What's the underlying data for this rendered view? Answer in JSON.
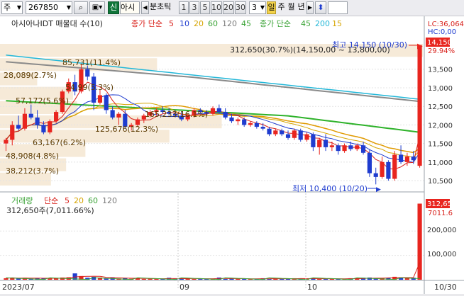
{
  "toolbar": {
    "market": "주",
    "code": "267850",
    "stock_name_short": "아시",
    "credit_badge": "신",
    "period_label": "분초틱",
    "periods": [
      "1",
      "3",
      "5",
      "10",
      "20",
      "30"
    ],
    "count_value": "3",
    "day_label": "일",
    "week_label": "주",
    "month_label": "월",
    "year_label": "년"
  },
  "price_panel": {
    "title": "아시아나IDT 매물대 수(10)",
    "ma_label": "종가 단순",
    "ma_periods": [
      "5",
      "10",
      "20",
      "60",
      "120"
    ],
    "ma_extra_label": "45",
    "ma2_label": "종가 단순",
    "ma2_periods": [
      "45",
      "200",
      "15"
    ],
    "lc_label": "LC:36,064",
    "hc_label": "HC:0,00",
    "current_price_badge": "14,150",
    "pct_badge": "29.94%",
    "price_annotation": "312,650(30.7%)(14,150,00 ~ 13,800,00)",
    "high_annotation": "최고 14,150 (10/30)",
    "low_annotation": "최저 10,400 (10/20)",
    "volume_profile_labels": [
      "85,731(11.4%)",
      "28,089(2.7%)",
      "54,99(5.3%)",
      "57,172(5.6%)",
      "165,233(16.1%)",
      "125,676(12.3%)",
      "63,167(6.2%)",
      "48,908(4.8%)",
      "38,212(3.7%)"
    ],
    "y_ticks": [
      "13,500",
      "13,000",
      "12,500",
      "12,000",
      "11,500",
      "11,000",
      "10,500"
    ]
  },
  "volume_panel": {
    "title": "거래량",
    "ma_label": "단순",
    "ma_periods": [
      "5",
      "20",
      "60",
      "120"
    ],
    "current_label": "312,650주(7,011.66%)",
    "value_badge": "312,65",
    "value_badge2": "7011.6",
    "y_ticks": [
      "200,000",
      "100,000"
    ]
  },
  "x_axis": [
    "2023/07",
    "09",
    "10",
    "10/30"
  ],
  "colors": {
    "up": "#e8251f",
    "down": "#1f3ccf",
    "profile": "#f6ead8"
  },
  "chart_data": {
    "type": "candlestick",
    "title": "아시아나IDT 매물대 수(10)",
    "ylim": [
      10350,
      14200
    ],
    "candles": [
      {
        "o": 11500,
        "h": 11650,
        "l": 11300,
        "c": 11600
      },
      {
        "o": 11600,
        "h": 12100,
        "l": 11450,
        "c": 12000
      },
      {
        "o": 12000,
        "h": 12250,
        "l": 11850,
        "c": 11900
      },
      {
        "o": 11900,
        "h": 12450,
        "l": 11850,
        "c": 12300
      },
      {
        "o": 12300,
        "h": 12550,
        "l": 12150,
        "c": 12200
      },
      {
        "o": 12200,
        "h": 12400,
        "l": 11900,
        "c": 12000
      },
      {
        "o": 12000,
        "h": 12100,
        "l": 11750,
        "c": 11800
      },
      {
        "o": 11800,
        "h": 12150,
        "l": 11750,
        "c": 12100
      },
      {
        "o": 12100,
        "h": 12400,
        "l": 12050,
        "c": 12350
      },
      {
        "o": 12350,
        "h": 12950,
        "l": 12300,
        "c": 12900
      },
      {
        "o": 12900,
        "h": 13250,
        "l": 12850,
        "c": 13150
      },
      {
        "o": 13150,
        "h": 13350,
        "l": 12800,
        "c": 12900
      },
      {
        "o": 12900,
        "h": 13650,
        "l": 12850,
        "c": 13500
      },
      {
        "o": 13500,
        "h": 13600,
        "l": 13200,
        "c": 13300
      },
      {
        "o": 13300,
        "h": 13400,
        "l": 12400,
        "c": 12600
      },
      {
        "o": 12600,
        "h": 12950,
        "l": 12550,
        "c": 12800
      },
      {
        "o": 12800,
        "h": 12850,
        "l": 12300,
        "c": 12400
      },
      {
        "o": 12400,
        "h": 12500,
        "l": 12150,
        "c": 12200
      },
      {
        "o": 12200,
        "h": 12350,
        "l": 12000,
        "c": 12300
      },
      {
        "o": 12300,
        "h": 12400,
        "l": 11900,
        "c": 11950
      },
      {
        "o": 11950,
        "h": 12050,
        "l": 11850,
        "c": 12000
      },
      {
        "o": 12000,
        "h": 12200,
        "l": 11950,
        "c": 12150
      },
      {
        "o": 12150,
        "h": 12300,
        "l": 12050,
        "c": 12250
      },
      {
        "o": 12250,
        "h": 12400,
        "l": 12200,
        "c": 12350
      },
      {
        "o": 12350,
        "h": 12450,
        "l": 12250,
        "c": 12400
      },
      {
        "o": 12400,
        "h": 12500,
        "l": 12300,
        "c": 12350
      },
      {
        "o": 12350,
        "h": 12450,
        "l": 12250,
        "c": 12300
      },
      {
        "o": 12300,
        "h": 12400,
        "l": 12200,
        "c": 12250
      },
      {
        "o": 12250,
        "h": 12350,
        "l": 12100,
        "c": 12150
      },
      {
        "o": 12150,
        "h": 12300,
        "l": 12100,
        "c": 12250
      },
      {
        "o": 12250,
        "h": 12450,
        "l": 12200,
        "c": 12400
      },
      {
        "o": 12400,
        "h": 12450,
        "l": 12300,
        "c": 12350
      },
      {
        "o": 12350,
        "h": 12400,
        "l": 12250,
        "c": 12300
      },
      {
        "o": 12300,
        "h": 12500,
        "l": 12250,
        "c": 12450
      },
      {
        "o": 12450,
        "h": 12550,
        "l": 12300,
        "c": 12350
      },
      {
        "o": 12350,
        "h": 12450,
        "l": 12150,
        "c": 12200
      },
      {
        "o": 12200,
        "h": 12300,
        "l": 12050,
        "c": 12100
      },
      {
        "o": 12100,
        "h": 12200,
        "l": 12000,
        "c": 12150
      },
      {
        "o": 12150,
        "h": 12200,
        "l": 11950,
        "c": 12000
      },
      {
        "o": 12000,
        "h": 12100,
        "l": 11950,
        "c": 12050
      },
      {
        "o": 12050,
        "h": 12100,
        "l": 11900,
        "c": 11950
      },
      {
        "o": 11950,
        "h": 12050,
        "l": 11850,
        "c": 11900
      },
      {
        "o": 11900,
        "h": 11950,
        "l": 11700,
        "c": 11750
      },
      {
        "o": 11750,
        "h": 11900,
        "l": 11700,
        "c": 11850
      },
      {
        "o": 11850,
        "h": 11900,
        "l": 11700,
        "c": 11750
      },
      {
        "o": 11750,
        "h": 11850,
        "l": 11600,
        "c": 11650
      },
      {
        "o": 11650,
        "h": 11900,
        "l": 11600,
        "c": 11850
      },
      {
        "o": 11850,
        "h": 11900,
        "l": 11550,
        "c": 11600
      },
      {
        "o": 11600,
        "h": 11800,
        "l": 11550,
        "c": 11750
      },
      {
        "o": 11750,
        "h": 11800,
        "l": 11300,
        "c": 11400
      },
      {
        "o": 11400,
        "h": 11650,
        "l": 11200,
        "c": 11600
      },
      {
        "o": 11600,
        "h": 11750,
        "l": 11300,
        "c": 11400
      },
      {
        "o": 11400,
        "h": 11550,
        "l": 11300,
        "c": 11450
      },
      {
        "o": 11450,
        "h": 11500,
        "l": 11200,
        "c": 11300
      },
      {
        "o": 11300,
        "h": 11500,
        "l": 11250,
        "c": 11450
      },
      {
        "o": 11450,
        "h": 11550,
        "l": 11300,
        "c": 11350
      },
      {
        "o": 11350,
        "h": 11500,
        "l": 11300,
        "c": 11450
      },
      {
        "o": 11450,
        "h": 11550,
        "l": 11200,
        "c": 11250
      },
      {
        "o": 11250,
        "h": 11350,
        "l": 10600,
        "c": 10700
      },
      {
        "o": 10700,
        "h": 10850,
        "l": 10400,
        "c": 10600
      },
      {
        "o": 10600,
        "h": 11150,
        "l": 10550,
        "c": 11000
      },
      {
        "o": 11000,
        "h": 11050,
        "l": 10500,
        "c": 10550
      },
      {
        "o": 10550,
        "h": 11300,
        "l": 10500,
        "c": 11200
      },
      {
        "o": 11200,
        "h": 11450,
        "l": 10950,
        "c": 11000
      },
      {
        "o": 11000,
        "h": 11250,
        "l": 10900,
        "c": 11150
      },
      {
        "o": 11150,
        "h": 11300,
        "l": 10950,
        "c": 11050
      },
      {
        "o": 10900,
        "h": 14150,
        "l": 10850,
        "c": 14150
      }
    ],
    "volume_ylim": [
      0,
      320000
    ],
    "volumes": [
      6000,
      9000,
      5000,
      8000,
      5000,
      7000,
      6000,
      5000,
      6000,
      9000,
      10000,
      26000,
      15000,
      8000,
      12000,
      9000,
      6000,
      8000,
      5000,
      7000,
      4000,
      6000,
      3000,
      5000,
      4000,
      3000,
      8000,
      4000,
      3000,
      5000,
      3000,
      6000,
      4000,
      3000,
      9000,
      3000,
      4000,
      5000,
      3000,
      4000,
      3000,
      6000,
      3000,
      5000,
      4000,
      3000,
      6000,
      5000,
      4000,
      5000,
      3000,
      4000,
      5000,
      4000,
      3000,
      6000,
      4000,
      8000,
      9000,
      7000,
      6000,
      8000,
      12000,
      10000,
      7000,
      8000,
      312650
    ],
    "volume_profile_pct": [
      3.7,
      4.8,
      6.2,
      12.3,
      16.1,
      5.6,
      5.3,
      2.7,
      11.4,
      30.7
    ]
  }
}
